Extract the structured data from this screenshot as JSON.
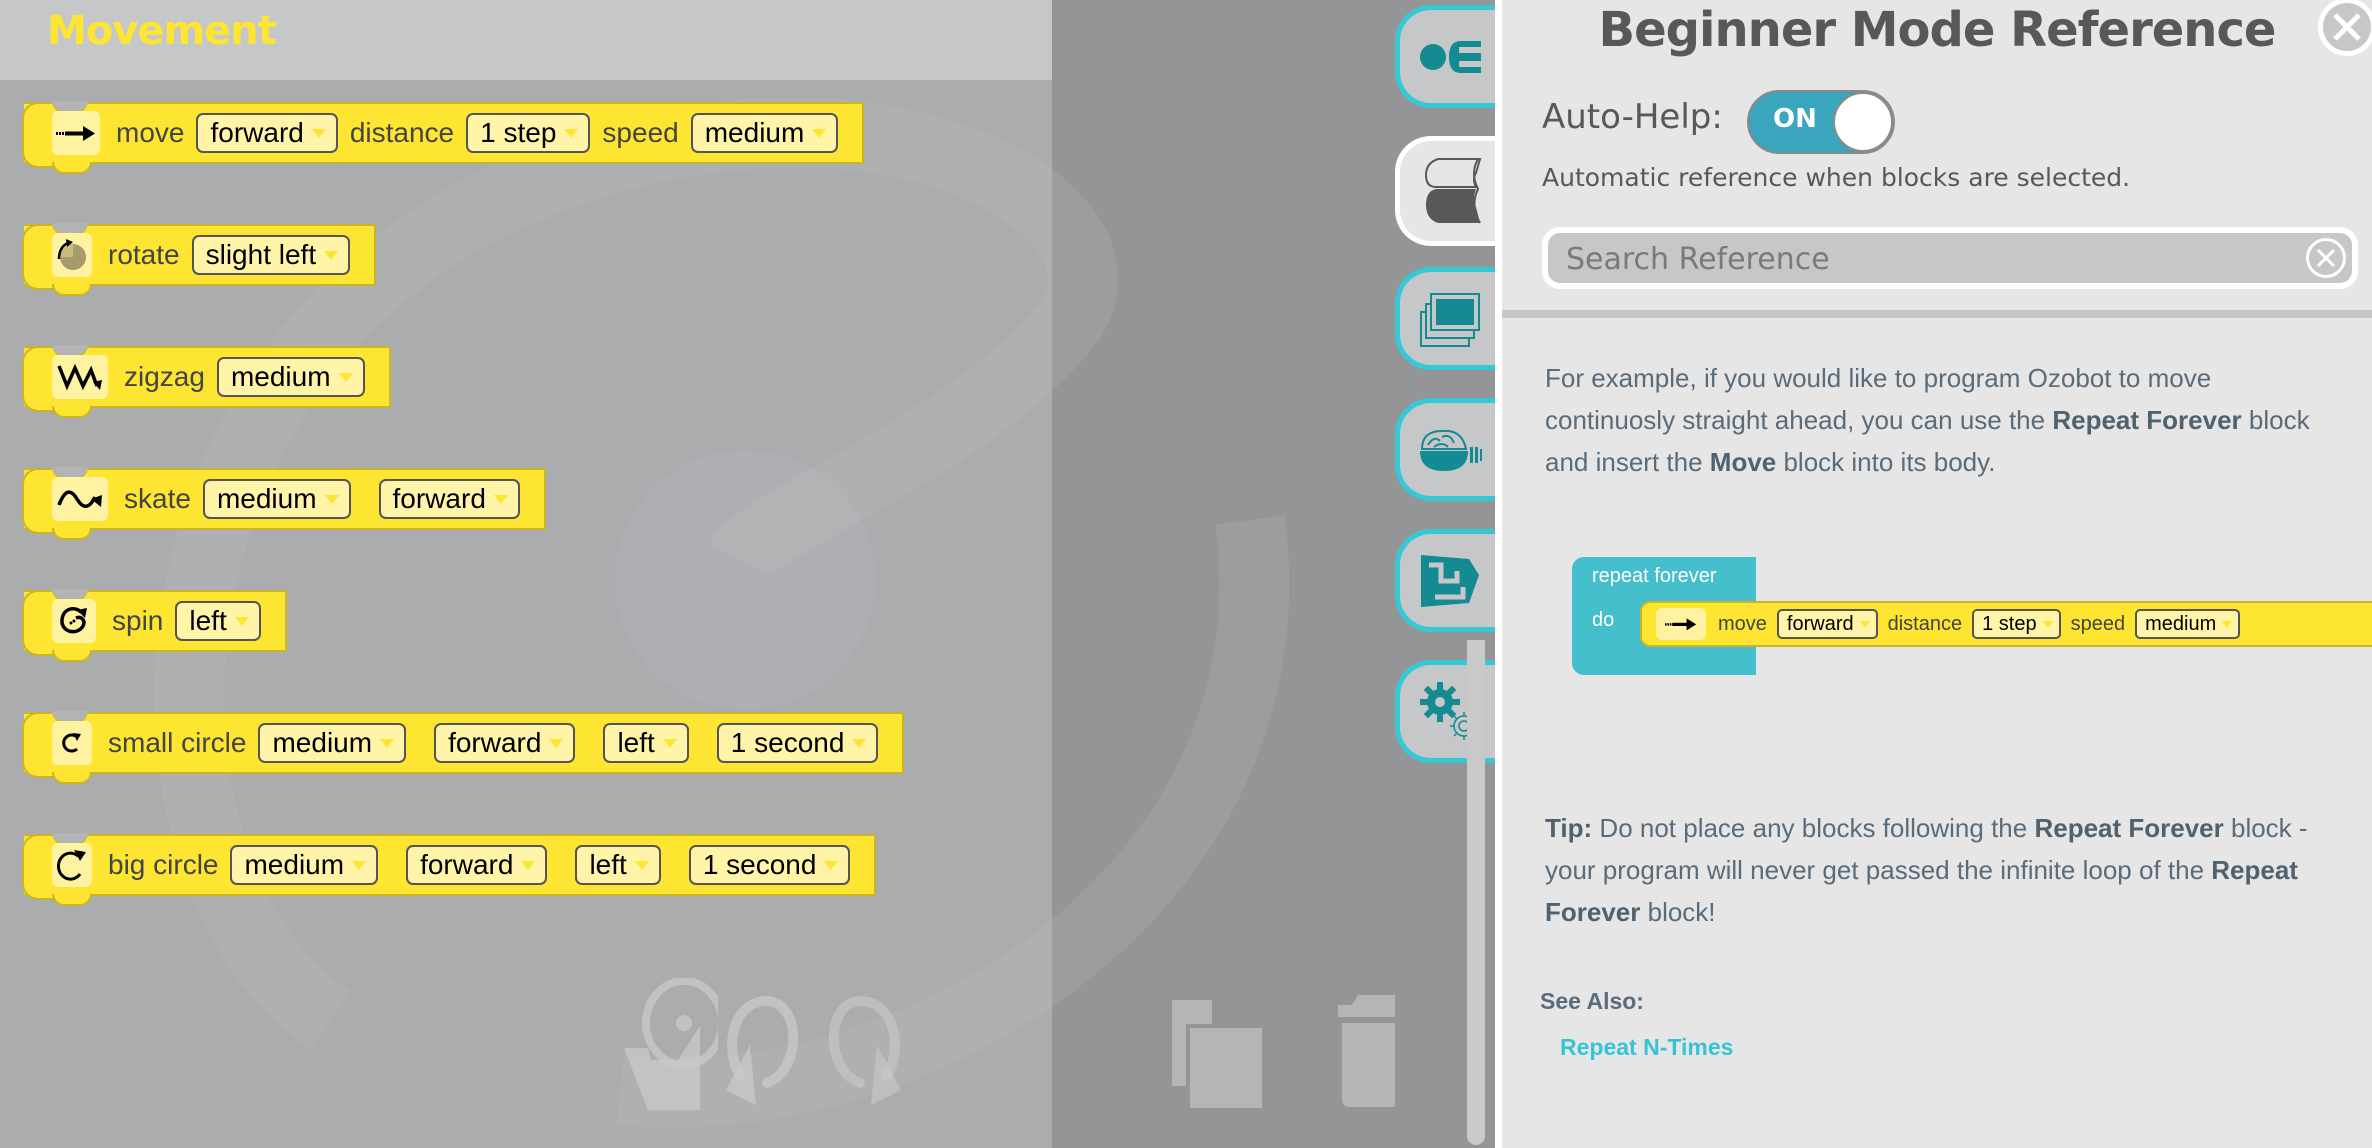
{
  "flyout": {
    "title": "Movement",
    "blocks": [
      {
        "icon": "move-arrow-icon",
        "label": "move",
        "fields": [
          {
            "value": "forward"
          },
          {
            "prefix": "distance",
            "value": "1 step"
          },
          {
            "prefix": "speed",
            "value": "medium"
          }
        ]
      },
      {
        "icon": "rotate-icon",
        "label": "rotate",
        "fields": [
          {
            "value": "slight left"
          }
        ]
      },
      {
        "icon": "zigzag-icon",
        "label": "zigzag",
        "fields": [
          {
            "value": "medium"
          }
        ]
      },
      {
        "icon": "skate-icon",
        "label": "skate",
        "fields": [
          {
            "value": "medium"
          },
          {
            "value": "forward"
          }
        ]
      },
      {
        "icon": "spin-icon",
        "label": "spin",
        "fields": [
          {
            "value": "left"
          }
        ]
      },
      {
        "icon": "small-circle-icon",
        "label": "small circle",
        "fields": [
          {
            "value": "medium"
          },
          {
            "value": "forward"
          },
          {
            "value": "left"
          },
          {
            "value": "1 second"
          }
        ]
      },
      {
        "icon": "big-circle-icon",
        "label": "big circle",
        "fields": [
          {
            "value": "medium"
          },
          {
            "value": "forward"
          },
          {
            "value": "left"
          },
          {
            "value": "1 second"
          }
        ]
      }
    ]
  },
  "toolbar": {
    "icons": [
      "open-file-icon",
      "undo-icon",
      "redo-icon",
      "copy-icon",
      "trash-icon"
    ]
  },
  "side_tabs": [
    {
      "name": "blocks-tab",
      "icon": "ozobot-logo-icon",
      "active": false
    },
    {
      "name": "reference-tab",
      "icon": "book-icon",
      "active": true
    },
    {
      "name": "gallery-tab",
      "icon": "gallery-icon",
      "active": false
    },
    {
      "name": "brain-tab",
      "icon": "brain-icon",
      "active": false
    },
    {
      "name": "challenges-tab",
      "icon": "maze-box-icon",
      "active": false
    },
    {
      "name": "settings-tab",
      "icon": "gears-icon",
      "active": false
    }
  ],
  "panel": {
    "title": "Beginner Mode Reference",
    "auto_help_label": "Auto-Help:",
    "auto_help_state": "ON",
    "auto_help_description": "Automatic reference when blocks are selected.",
    "search_placeholder": "Search Reference",
    "search_value": "",
    "intro": {
      "t1": "For example, if you would like to program Ozobot to move continuosly straight ahead, you can use the ",
      "b1": "Repeat Forever",
      "t2": " block and insert the ",
      "b2": "Move",
      "t3": " block into its body."
    },
    "example": {
      "repeat_label": "repeat forever",
      "do_label": "do",
      "move_label": "move",
      "direction": "forward",
      "distance_label": "distance",
      "distance": "1 step",
      "speed_label": "speed",
      "speed": "medium"
    },
    "tip": {
      "label": "Tip:",
      "t1": " Do not place any blocks following the ",
      "b1": "Repeat Forever",
      "t2": " block - your program will never get passed the infinite loop of the ",
      "b2": "Repeat Forever",
      "t3": " block!"
    },
    "see_also_label": "See Also:",
    "see_also_links": [
      "Repeat N-Times"
    ]
  },
  "colors": {
    "block_yellow": "#fde532",
    "accent_teal": "#35c9d6",
    "repeat_block": "#45bfcb",
    "toggle_on": "#3aa5bd",
    "link": "#35c4d6"
  }
}
